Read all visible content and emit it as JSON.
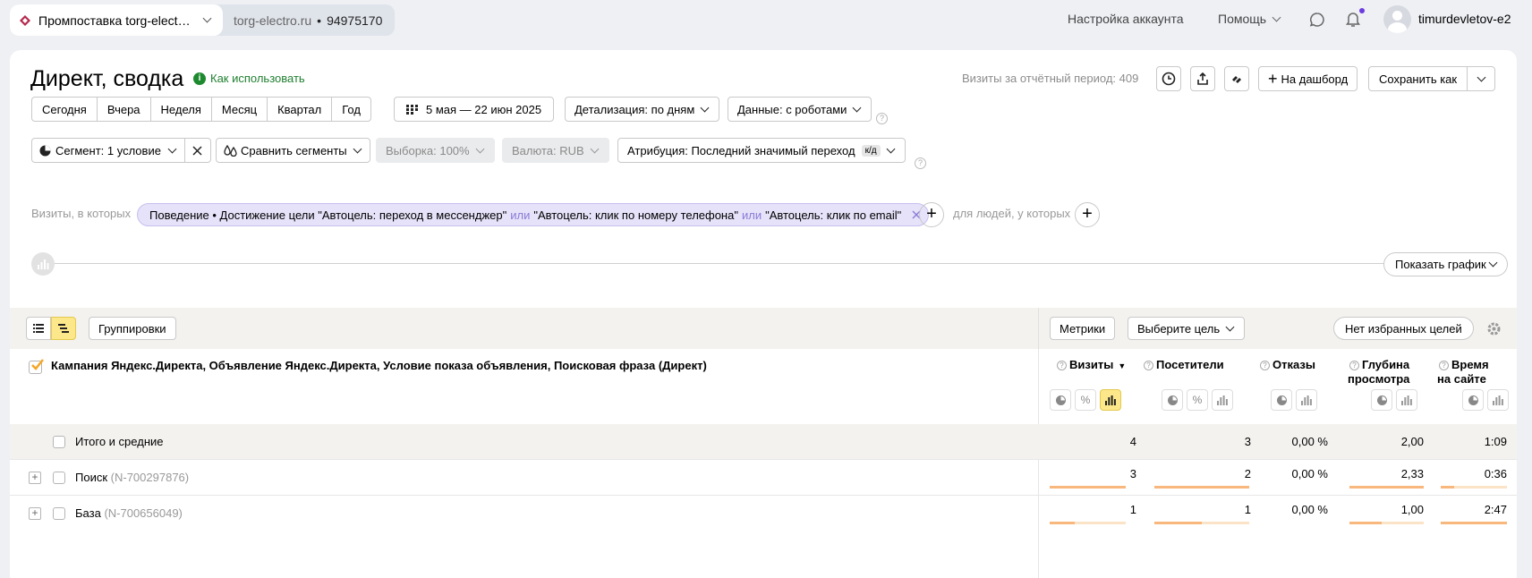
{
  "topbar": {
    "counter_name": "Промпоставка torg-elect…",
    "site": "torg-electro.ru",
    "counter_id": "94975170",
    "account_settings": "Настройка аккаунта",
    "help": "Помощь",
    "username": "timurdevletov-e2"
  },
  "header": {
    "title": "Директ, сводка",
    "howto": "Как использовать",
    "visits_period": "Визиты за отчётный период: 409",
    "to_dashboard": "На дашборд",
    "save_as": "Сохранить как"
  },
  "periods": [
    "Сегодня",
    "Вчера",
    "Неделя",
    "Месяц",
    "Квартал",
    "Год"
  ],
  "date_range": "5 мая — 22 июн 2025",
  "detail": "Детализация: по дням",
  "data_mode": "Данные: с роботами",
  "filters": {
    "segment": "Сегмент: 1 условие",
    "compare": "Сравнить сегменты",
    "sample": "Выборка: 100%",
    "currency": "Валюта: RUB",
    "attribution": "Атрибуция: Последний значимый переход",
    "attribution_badge": "к/д"
  },
  "condition": {
    "prefix": "Визиты, в которых",
    "part1": "Поведение • Достижение цели \"Автоцель: переход в мессенджер\"",
    "or1": "или",
    "part2": "\"Автоцель: клик по номеру телефона\"",
    "or2": "или",
    "part3": "\"Автоцель: клик по email\"",
    "people": "для людей, у которых"
  },
  "show_chart": "Показать график",
  "toolbar": {
    "groupings": "Группировки",
    "metrics": "Метрики",
    "choose_goal": "Выберите цель",
    "no_favorites": "Нет избранных целей"
  },
  "table": {
    "dimension_header": "Кампания Яндекс.Директа, Объявление Яндекс.Директа, Условие показа объявления, Поисковая фраза (Директ)",
    "columns": [
      {
        "line1": "Визиты",
        "line2": ""
      },
      {
        "line1": "Посетители",
        "line2": ""
      },
      {
        "line1": "Отказы",
        "line2": ""
      },
      {
        "line1": "Глубина",
        "line2": "просмотра"
      },
      {
        "line1": "Время",
        "line2": "на сайте"
      }
    ],
    "totals": {
      "label": "Итого и средние",
      "values": [
        "4",
        "3",
        "0,00 %",
        "2,00",
        "1:09"
      ]
    },
    "rows": [
      {
        "name": "Поиск",
        "id": "(N-700297876)",
        "values": [
          "3",
          "2",
          "0,00 %",
          "2,33",
          "0:36"
        ],
        "fills": [
          1.0,
          1.0,
          0,
          1.0,
          0.2
        ]
      },
      {
        "name": "База",
        "id": "(N-700656049)",
        "values": [
          "1",
          "1",
          "0,00 %",
          "1,00",
          "2:47"
        ],
        "fills": [
          0.33,
          0.5,
          0,
          0.43,
          1.0
        ]
      }
    ]
  }
}
